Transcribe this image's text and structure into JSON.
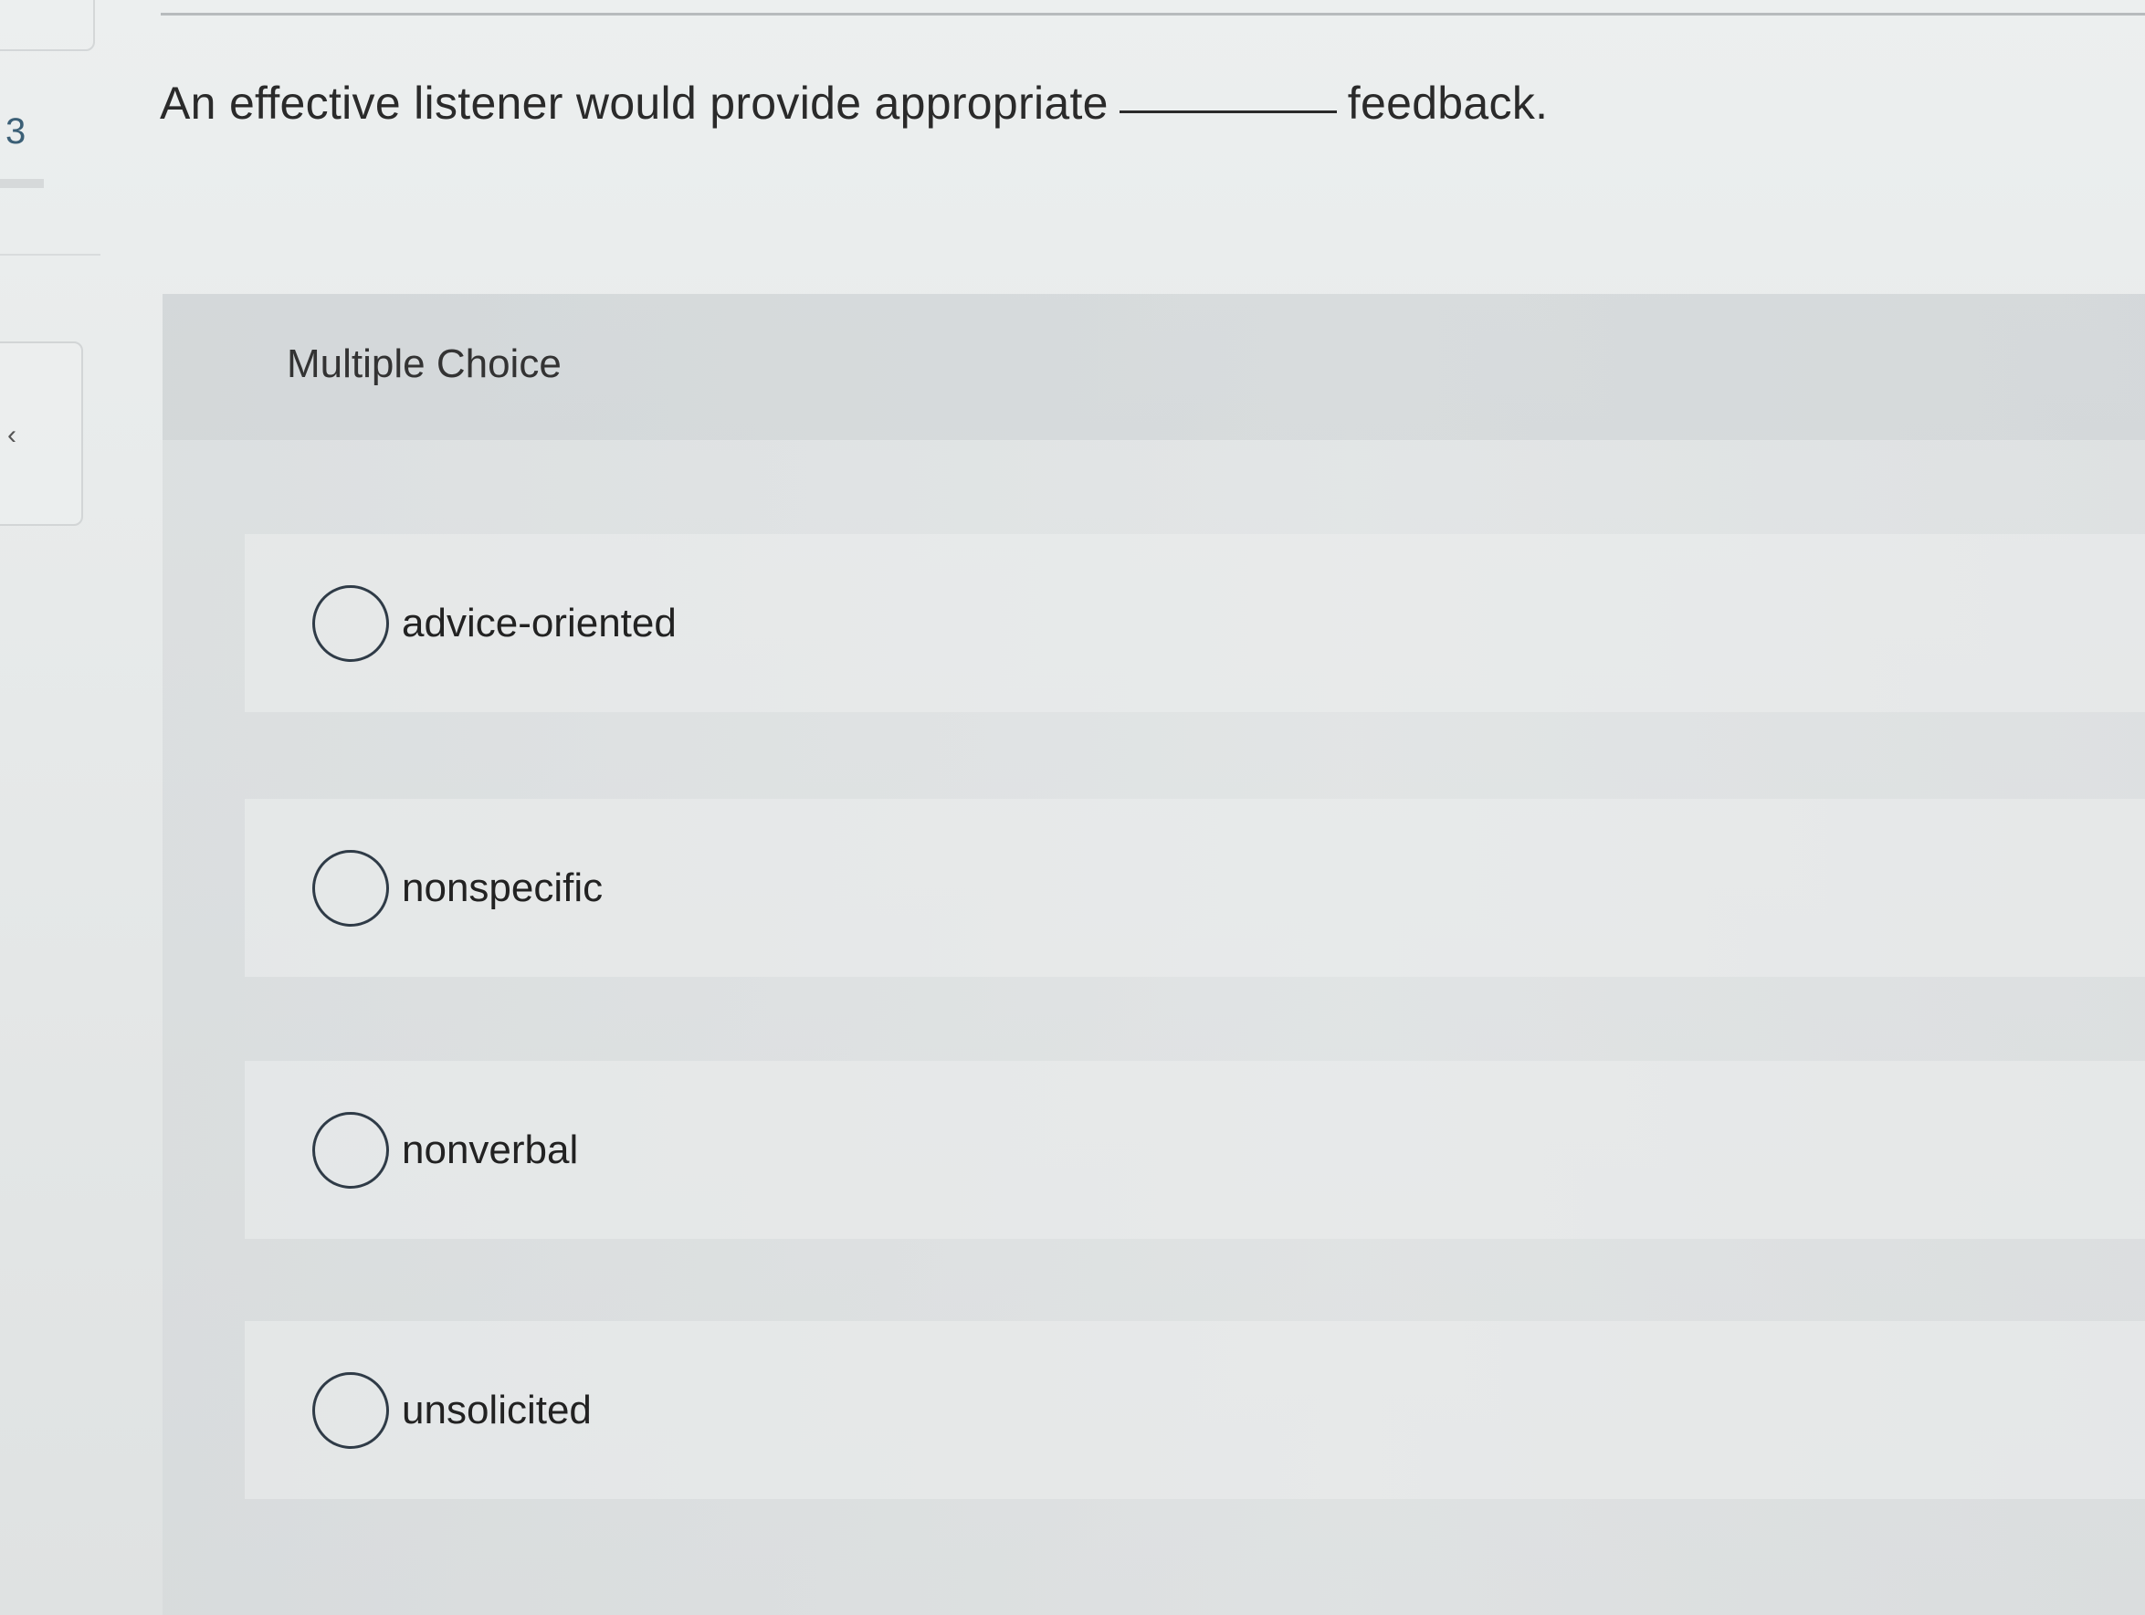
{
  "question": {
    "number": "3",
    "text_before": "An effective listener would provide appropriate",
    "text_after": "feedback."
  },
  "sidebar": {
    "collapse_icon": "chevron-left-icon"
  },
  "multiple_choice": {
    "label": "Multiple Choice",
    "options": [
      {
        "label": "advice-oriented",
        "selected": false
      },
      {
        "label": "nonspecific",
        "selected": false
      },
      {
        "label": "nonverbal",
        "selected": false
      },
      {
        "label": "unsolicited",
        "selected": false
      }
    ]
  },
  "colors": {
    "question_number": "#3b5f76",
    "radio_border": "#2f3b47"
  }
}
